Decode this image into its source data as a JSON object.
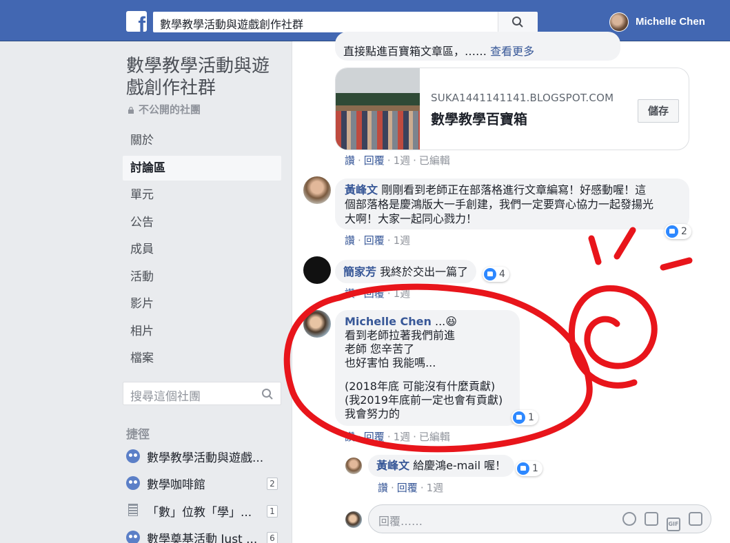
{
  "topbar": {
    "logo": "f",
    "search_value": "數學教學活動與遊戲創作社群",
    "user_name": "Michelle Chen"
  },
  "sidebar": {
    "group_title": "數學教學活動與遊戲創作社群",
    "privacy": "不公開的社團",
    "nav": [
      "關於",
      "討論區",
      "單元",
      "公告",
      "成員",
      "活動",
      "影片",
      "相片",
      "檔案"
    ],
    "active_nav": "討論區",
    "search_placeholder": "搜尋這個社團",
    "shortcuts_heading": "捷徑",
    "shortcuts": [
      {
        "label": "數學教學活動與遊戲...",
        "count": ""
      },
      {
        "label": "數學咖啡館",
        "count": "2"
      },
      {
        "label": "「數」位教「學」...",
        "count": "1"
      },
      {
        "label": "數學奠基活動 Just ...",
        "count": "6"
      }
    ]
  },
  "feed": {
    "post_tail": "直接點進百寶箱文章區，……",
    "see_more": "查看更多",
    "link_card": {
      "domain": "SUKA1441141141.BLOGSPOT.COM",
      "title": "數學教學百寶箱",
      "save": "儲存"
    },
    "actions_labels": {
      "like": "讚",
      "reply": "回覆",
      "edited": "已編輯"
    },
    "comments": [
      {
        "time": "1週",
        "edited": true
      },
      {
        "author": "黃峰文",
        "text": "剛剛看到老師正在部落格進行文章編寫！好感動喔！這個部落格是慶鴻版大一手創建，我們一定要齊心協力一起發揚光大啊！大家一起同心戮力！",
        "lines": [
          "剛剛看到老師正在部落格進行文章編寫！好感動喔！這",
          "個部落格是慶鴻版大一手創建，我們一定要齊心協力一起發揚光",
          "大啊！大家一起同心戮力！"
        ],
        "likes": "2",
        "time": "1週"
      },
      {
        "author": "簡家芳",
        "text": "我終於交出一篇了",
        "likes": "4",
        "time": "1週"
      },
      {
        "author": "Michelle Chen",
        "emoji": "...😆",
        "lines": [
          "看到老師拉著我們前進",
          "老師 您辛苦了",
          "也好害怕 我能嗎...",
          "",
          "(2018年底 可能沒有什麼貢獻)",
          "(我2019年底前一定也會有貢獻)",
          "我會努力的"
        ],
        "likes": "1",
        "time": "1週",
        "edited": true
      },
      {
        "author": "黃峰文",
        "text": "給慶鴻e-mail 喔！",
        "likes": "1",
        "time": "1週"
      }
    ],
    "reply_placeholder": "回覆……"
  }
}
